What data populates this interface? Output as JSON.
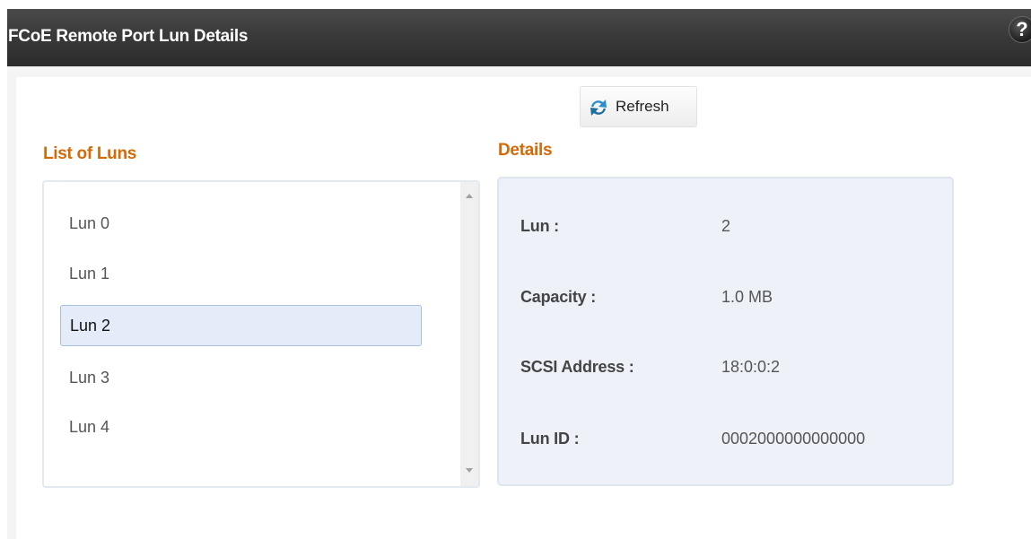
{
  "header": {
    "title": "FCoE Remote Port Lun Details",
    "help_glyph": "?"
  },
  "toolbar": {
    "refresh_label": "Refresh",
    "refresh_icon": "refresh-icon"
  },
  "lun_list": {
    "heading": "List of Luns",
    "items": [
      {
        "label": "Lun 0",
        "selected": false
      },
      {
        "label": "Lun 1",
        "selected": false
      },
      {
        "label": "Lun 2",
        "selected": true
      },
      {
        "label": "Lun 3",
        "selected": false
      },
      {
        "label": "Lun 4",
        "selected": false
      }
    ]
  },
  "details": {
    "heading": "Details",
    "fields": [
      {
        "label": "Lun :",
        "value": "2"
      },
      {
        "label": "Capacity :",
        "value": "1.0 MB"
      },
      {
        "label": "SCSI Address :",
        "value": "18:0:0:2"
      },
      {
        "label": "Lun ID :",
        "value": "0002000000000000"
      }
    ]
  },
  "colors": {
    "accent_heading": "#d46a07",
    "titlebar": "#3a3a3a",
    "selected_bg": "#e3ecf8",
    "details_bg": "#eef2f8"
  }
}
